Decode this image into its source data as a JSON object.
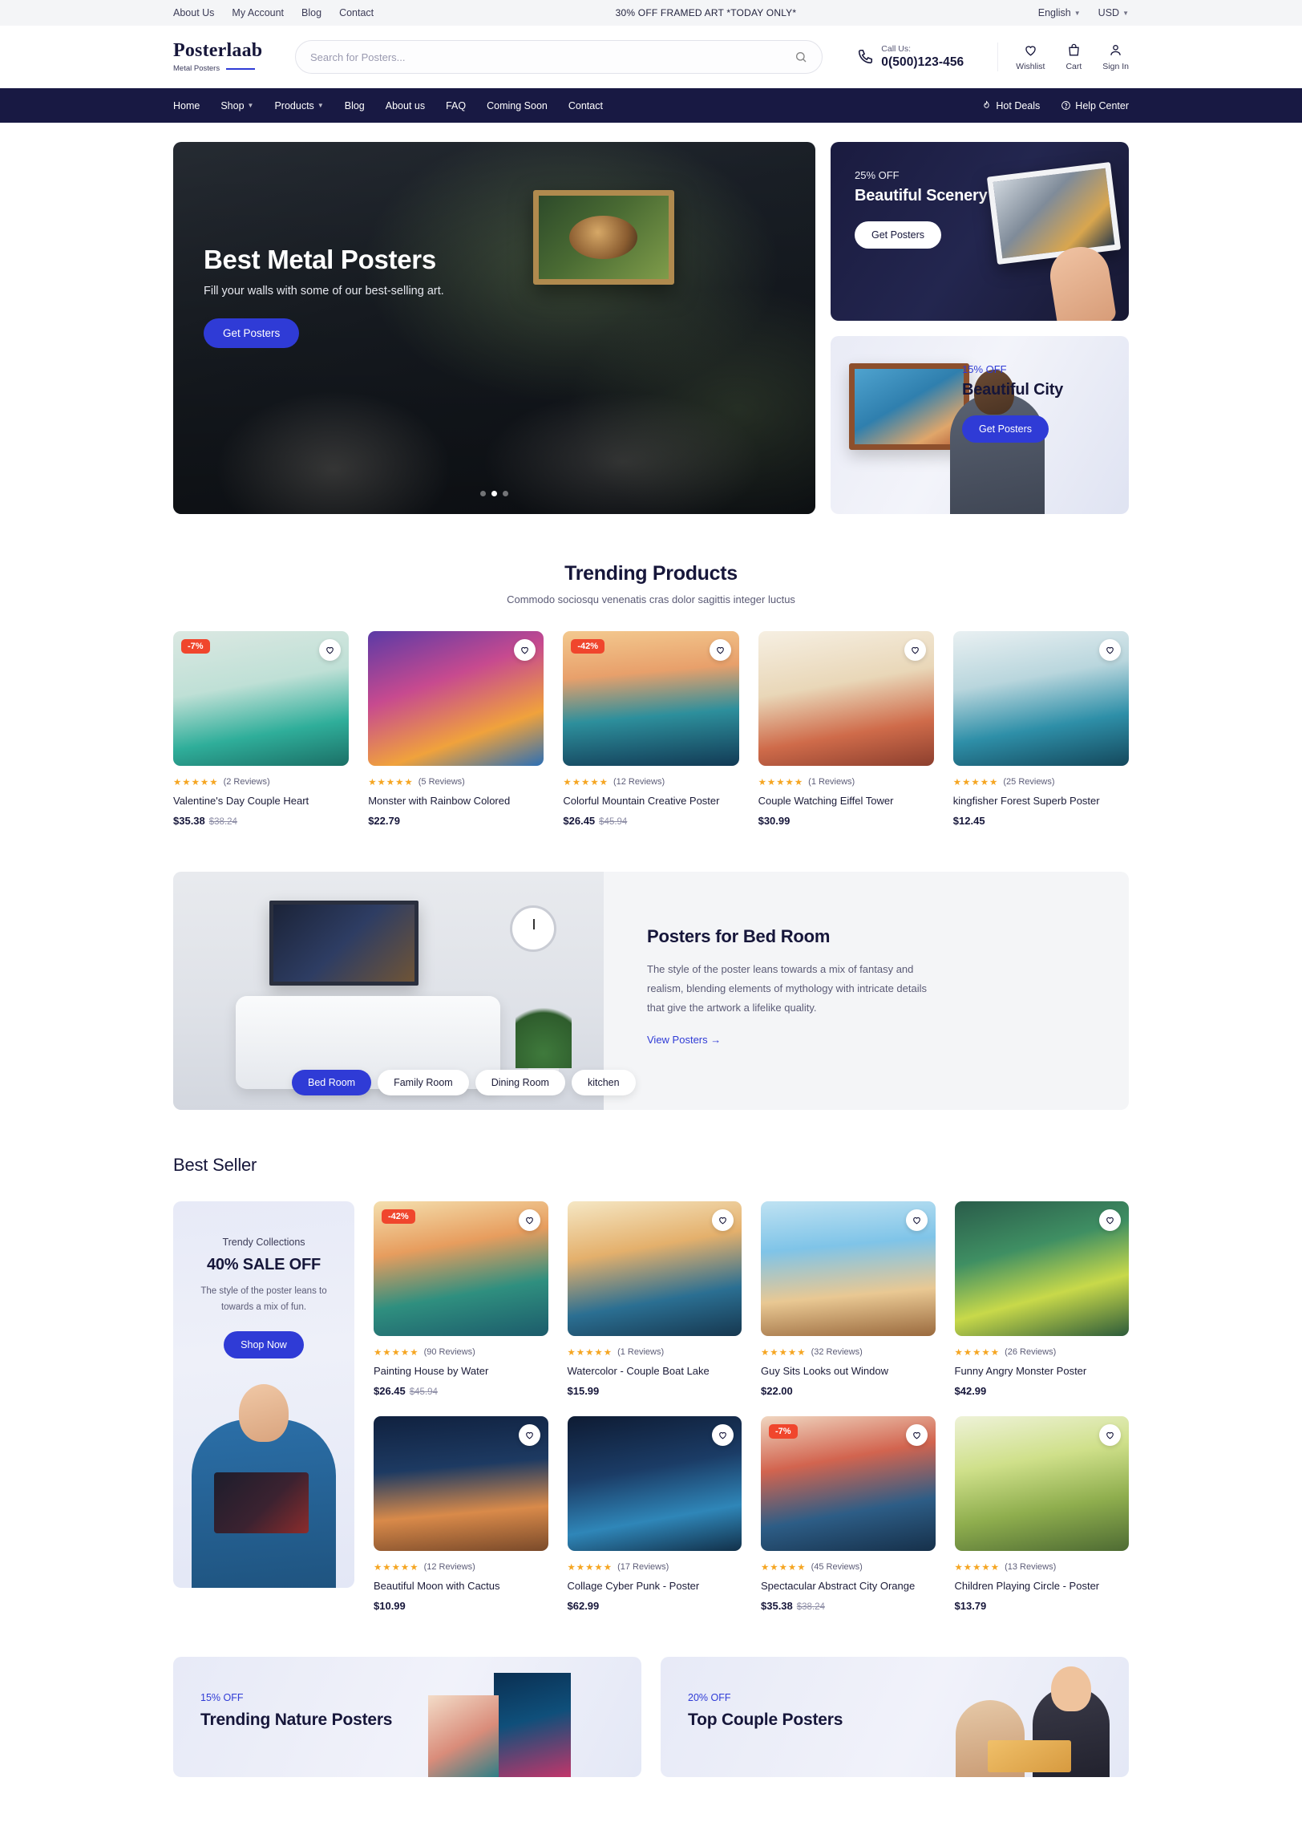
{
  "topbar": {
    "links": [
      "About Us",
      "My Account",
      "Blog",
      "Contact"
    ],
    "announcement": "30% OFF FRAMED ART *TODAY ONLY*",
    "language": "English",
    "currency": "USD"
  },
  "header": {
    "logo_main": "Posterlaab",
    "logo_sub": "Metal Posters",
    "search_placeholder": "Search for Posters...",
    "search_value": "",
    "call_label": "Call Us:",
    "phone": "0(500)123-456",
    "actions": [
      {
        "label": "Wishlist",
        "icon": "heart-icon"
      },
      {
        "label": "Cart",
        "icon": "cart-icon"
      },
      {
        "label": "Sign In",
        "icon": "user-icon"
      }
    ]
  },
  "nav": {
    "items": [
      {
        "label": "Home",
        "has_caret": false
      },
      {
        "label": "Shop",
        "has_caret": true
      },
      {
        "label": "Products",
        "has_caret": true
      },
      {
        "label": "Blog",
        "has_caret": false
      },
      {
        "label": "About us",
        "has_caret": false
      },
      {
        "label": "FAQ",
        "has_caret": false
      },
      {
        "label": "Coming Soon",
        "has_caret": false
      },
      {
        "label": "Contact",
        "has_caret": false
      }
    ],
    "hot_deals": "Hot Deals",
    "help_center": "Help Center"
  },
  "hero": {
    "title": "Best Metal Posters",
    "subtitle": "Fill your walls with some of our best-selling art.",
    "cta": "Get Posters",
    "slides_total": 3,
    "active_slide": 2,
    "promo_scenery": {
      "off": "25% OFF",
      "title": "Beautiful Scenery",
      "cta": "Get Posters"
    },
    "promo_city": {
      "off": "15% OFF",
      "title": "Beautiful City",
      "cta": "Get Posters"
    }
  },
  "trending": {
    "title": "Trending Products",
    "subtitle": "Commodo sociosqu venenatis cras dolor sagittis integer luctus",
    "products": [
      {
        "name": "Valentine's Day Couple Heart",
        "price": "$35.38",
        "old_price": "$38.24",
        "reviews": "(2 Reviews)",
        "badge": "-7%",
        "art": "t1"
      },
      {
        "name": "Monster with Rainbow Colored",
        "price": "$22.79",
        "old_price": "",
        "reviews": "(5 Reviews)",
        "badge": "",
        "art": "t2"
      },
      {
        "name": "Colorful Mountain Creative Poster",
        "price": "$26.45",
        "old_price": "$45.94",
        "reviews": "(12 Reviews)",
        "badge": "-42%",
        "art": "t3"
      },
      {
        "name": "Couple Watching Eiffel Tower",
        "price": "$30.99",
        "old_price": "",
        "reviews": "(1 Reviews)",
        "badge": "",
        "art": "t4"
      },
      {
        "name": "kingfisher Forest Superb Poster",
        "price": "$12.45",
        "old_price": "",
        "reviews": "(25 Reviews)",
        "badge": "",
        "art": "t5"
      }
    ]
  },
  "room": {
    "title": "Posters for Bed Room",
    "description": "The style of the poster leans towards a mix of fantasy and realism, blending elements of mythology with intricate details that give the artwork a lifelike quality.",
    "link": "View Posters",
    "tabs": [
      "Bed Room",
      "Family Room",
      "Dining Room",
      "kitchen"
    ],
    "active_tab": "Bed Room"
  },
  "best_seller": {
    "title": "Best Seller",
    "promo": {
      "eyebrow": "Trendy  Collections",
      "headline": "40% SALE OFF",
      "text": "The style of the poster leans to towards a mix of fun.",
      "cta": "Shop Now"
    },
    "products": [
      {
        "name": "Painting House by Water",
        "price": "$26.45",
        "old_price": "$45.94",
        "reviews": "(90 Reviews)",
        "badge": "-42%",
        "art": "t6"
      },
      {
        "name": "Watercolor - Couple Boat Lake",
        "price": "$15.99",
        "old_price": "",
        "reviews": "(1 Reviews)",
        "badge": "",
        "art": "t7"
      },
      {
        "name": "Guy Sits Looks out Window",
        "price": "$22.00",
        "old_price": "",
        "reviews": "(32 Reviews)",
        "badge": "",
        "art": "t8"
      },
      {
        "name": "Funny Angry Monster Poster",
        "price": "$42.99",
        "old_price": "",
        "reviews": "(26 Reviews)",
        "badge": "",
        "art": "t9"
      },
      {
        "name": "Beautiful Moon with Cactus",
        "price": "$10.99",
        "old_price": "",
        "reviews": "(12 Reviews)",
        "badge": "",
        "art": "t10"
      },
      {
        "name": "Collage Cyber Punk - Poster",
        "price": "$62.99",
        "old_price": "",
        "reviews": "(17 Reviews)",
        "badge": "",
        "art": "t11"
      },
      {
        "name": "Spectacular Abstract City Orange",
        "price": "$35.38",
        "old_price": "$38.24",
        "reviews": "(45 Reviews)",
        "badge": "-7%",
        "art": "t12"
      },
      {
        "name": "Children Playing Circle - Poster",
        "price": "$13.79",
        "old_price": "",
        "reviews": "(13 Reviews)",
        "badge": "",
        "art": "t13"
      }
    ]
  },
  "bottom_banners": [
    {
      "off": "15% OFF",
      "title": "Trending Nature Posters"
    },
    {
      "off": "20% OFF",
      "title": "Top Couple Posters"
    }
  ],
  "colors": {
    "accent": "#2f3bd6",
    "nav_bg": "#181943",
    "badge": "#f0462d",
    "star": "#f5a623"
  }
}
